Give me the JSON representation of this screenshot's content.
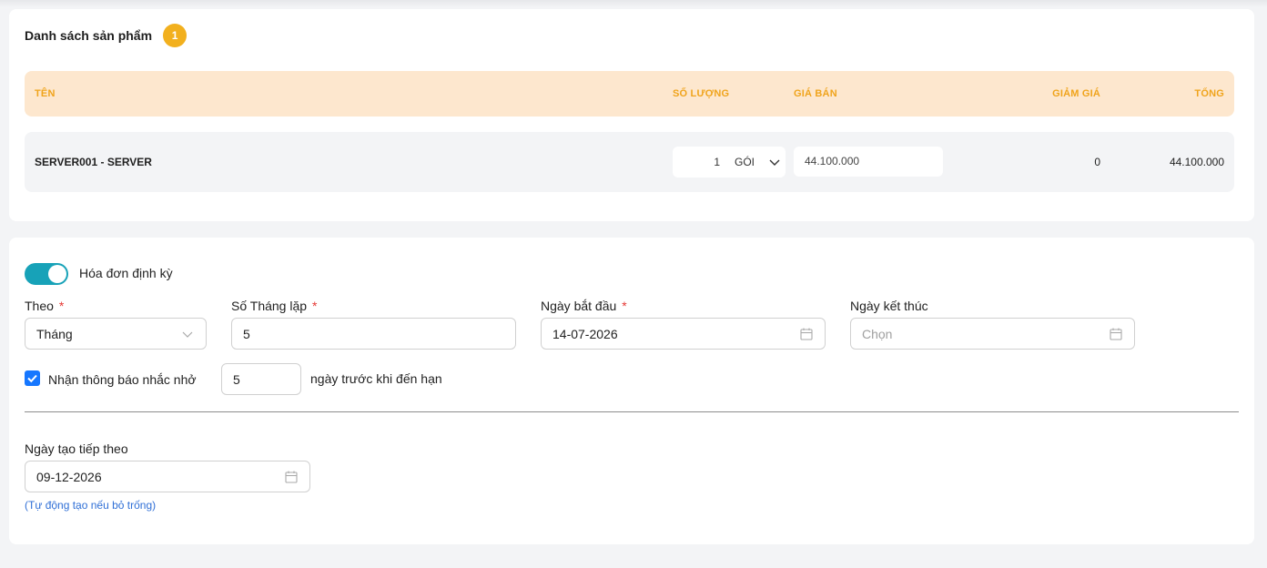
{
  "products": {
    "title": "Danh sách sản phẩm",
    "count": "1",
    "columns": {
      "name": "TÊN",
      "quantity": "SỐ LƯỢNG",
      "price": "GIÁ BÁN",
      "discount": "GIẢM GIÁ",
      "total": "TỔNG"
    },
    "rows": [
      {
        "name": "SERVER001 - SERVER",
        "quantity": "1",
        "unit": "GÓI",
        "price": "44.100.000",
        "discount": "0",
        "total": "44.100.000"
      }
    ]
  },
  "recurring": {
    "toggle_label": "Hóa đơn định kỳ",
    "toggle_on": true,
    "by_label": "Theo",
    "by_value": "Tháng",
    "repeat_label": "Số Tháng lặp",
    "repeat_value": "5",
    "start_label": "Ngày bắt đầu",
    "start_value": "14-07-2026",
    "end_label": "Ngày kết thúc",
    "end_placeholder": "Chọn",
    "required_mark": "*",
    "reminder_label": "Nhận thông báo nhắc nhở",
    "reminder_checked": true,
    "reminder_days": "5",
    "reminder_suffix": "ngày trước khi đến hạn",
    "next_label": "Ngày tạo tiếp theo",
    "next_value": "09-12-2026",
    "next_hint": "(Tự động tạo nếu bỏ trống)"
  },
  "colors": {
    "accent": "#f2b01e",
    "toggle": "#17a2b8",
    "checkbox": "#1677ff",
    "required": "#e53935",
    "hint": "#2f6fd6"
  },
  "icons": {
    "chevron": "chevron-down-icon",
    "calendar": "calendar-icon",
    "check": "check-icon"
  }
}
